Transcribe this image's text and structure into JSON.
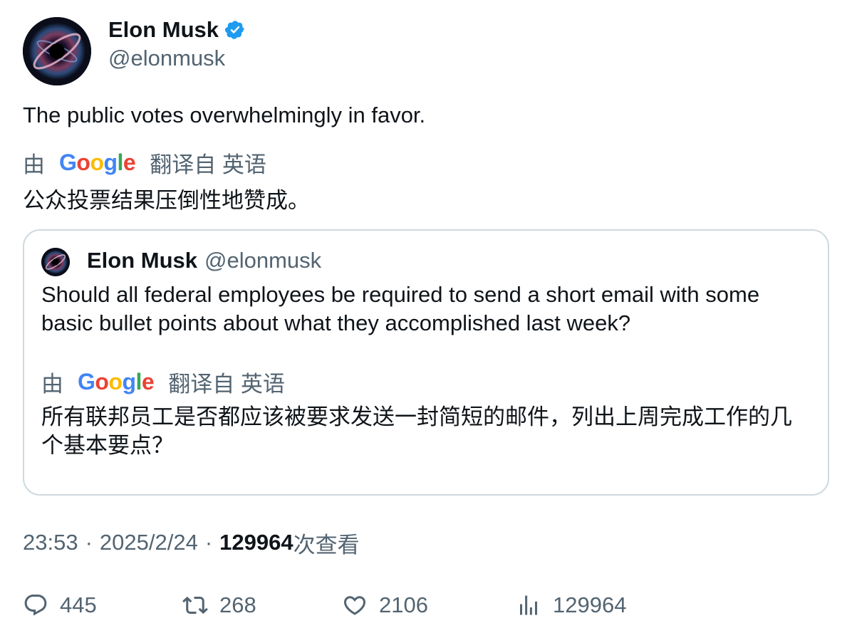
{
  "author": {
    "name": "Elon Musk",
    "handle": "@elonmusk",
    "verified_icon": "verified-badge-icon",
    "badge_color": "#1d9bf0"
  },
  "tweet": {
    "text": "The public votes overwhelmingly in favor.",
    "translation": {
      "prefix": "由",
      "provider": "Google",
      "suffix": "翻译自 英语",
      "text": "公众投票结果压倒性地赞成。"
    }
  },
  "quoted": {
    "name": "Elon Musk",
    "handle": "@elonmusk",
    "text": "Should all federal employees be required to send a short email with some basic bullet points about what they accomplished last week?",
    "translation": {
      "prefix": "由",
      "provider": "Google",
      "suffix": "翻译自 英语",
      "text": "所有联邦员工是否都应该被要求发送一封简短的邮件，列出上周完成工作的几个基本要点？"
    }
  },
  "meta": {
    "time": "23:53",
    "sep": "·",
    "date": "2025/2/24",
    "views_count": "129964",
    "views_label": "次查看"
  },
  "actions": {
    "replies": "445",
    "retweets": "268",
    "likes": "2106",
    "views": "129964"
  },
  "colors": {
    "text": "#0f1419",
    "muted": "#536471",
    "border": "#cfd9de",
    "google_blue": "#4285F4",
    "google_red": "#EA4335",
    "google_yellow": "#FBBC05",
    "google_green": "#34A853"
  }
}
